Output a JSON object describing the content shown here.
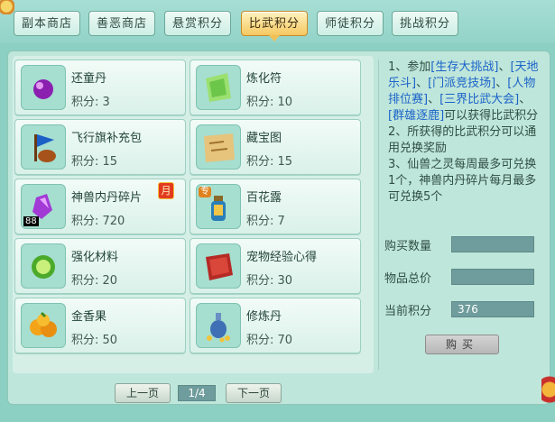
{
  "tabs": [
    {
      "label": "副本商店"
    },
    {
      "label": "善恶商店"
    },
    {
      "label": "悬赏积分"
    },
    {
      "label": "比武积分"
    },
    {
      "label": "师徒积分"
    },
    {
      "label": "挑战积分"
    }
  ],
  "active_tab": "比武积分",
  "items": [
    {
      "name": "还童丹",
      "score": "积分: 3",
      "icon": "purple-pill-icon"
    },
    {
      "name": "炼化符",
      "score": "积分: 10",
      "icon": "talisman-icon"
    },
    {
      "name": "飞行旗补充包",
      "score": "积分: 15",
      "icon": "flag-pack-icon"
    },
    {
      "name": "藏宝图",
      "score": "积分: 15",
      "icon": "treasure-map-icon"
    },
    {
      "name": "神兽内丹碎片",
      "score": "积分: 720",
      "icon": "crystal-shard-icon",
      "badge": "月",
      "qty": "88"
    },
    {
      "name": "百花露",
      "score": "积分: 7",
      "icon": "potion-bottle-icon",
      "tag": "专"
    },
    {
      "name": "强化材料",
      "score": "积分: 20",
      "icon": "green-orb-icon"
    },
    {
      "name": "宠物经验心得",
      "score": "积分: 30",
      "icon": "red-book-icon"
    },
    {
      "name": "金香果",
      "score": "积分: 50",
      "icon": "golden-fruit-icon"
    },
    {
      "name": "修炼丹",
      "score": "积分: 70",
      "icon": "vase-pills-icon"
    }
  ],
  "info": {
    "line1_pre": "1、参加",
    "events": [
      "[生存大挑战]",
      "[天地乐斗]",
      "[门派竞技场]",
      "[人物排位赛]",
      "[三界比武大会]",
      "[群雄逐鹿]"
    ],
    "line1_post": "可以获得比武积分",
    "line2": "2、所获得的比武积分可以通用兑换奖励",
    "line3": "3、仙兽之灵每周最多可兑换1个，神兽内丹碎片每月最多可兑换5个"
  },
  "purchase": {
    "qty_label": "购买数量",
    "qty_value": "",
    "total_label": "物品总价",
    "total_value": "",
    "current_label": "当前积分",
    "current_value": "376",
    "buy_label": "购买"
  },
  "pager": {
    "prev_label": "上一页",
    "page": "1/4",
    "next_label": "下一页"
  }
}
